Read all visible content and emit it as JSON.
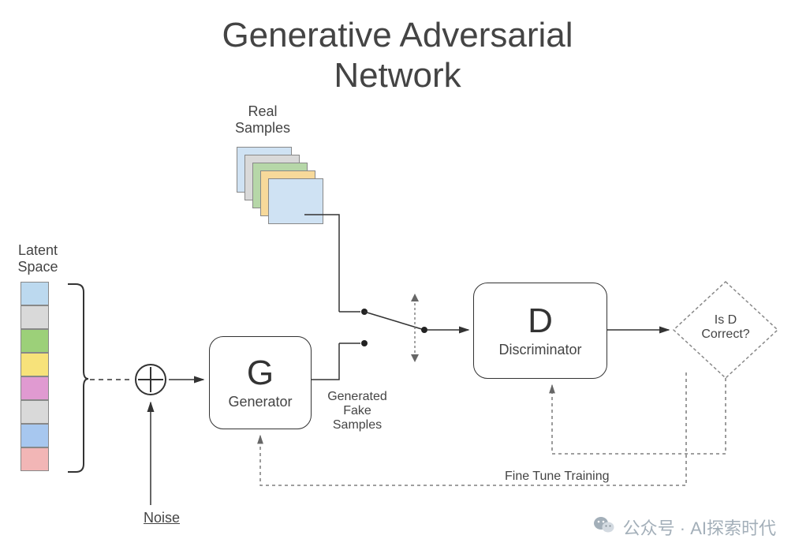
{
  "title_line1": "Generative Adversarial",
  "title_line2": "Network",
  "labels": {
    "latent_space": "Latent\nSpace",
    "noise": "Noise",
    "real_samples": "Real\nSamples",
    "generated_fake_samples": "Generated\nFake\nSamples",
    "is_d_correct": "Is D\nCorrect?",
    "fine_tune": "Fine Tune Training"
  },
  "nodes": {
    "generator_letter": "G",
    "generator_label": "Generator",
    "discriminator_letter": "D",
    "discriminator_label": "Discriminator"
  },
  "latent_colors": [
    "#bcd9ef",
    "#d9d9d9",
    "#9cd079",
    "#f7e27a",
    "#e09ad1",
    "#d9d9d9",
    "#a7c7ef",
    "#f2b6b6"
  ],
  "sample_colors": [
    "#cfe2f3",
    "#d9d9d9",
    "#b6d7a8",
    "#f7d99a",
    "#cfe2f3"
  ],
  "watermark": {
    "text": "公众号 · AI探索时代",
    "icon": "wechat-icon"
  }
}
